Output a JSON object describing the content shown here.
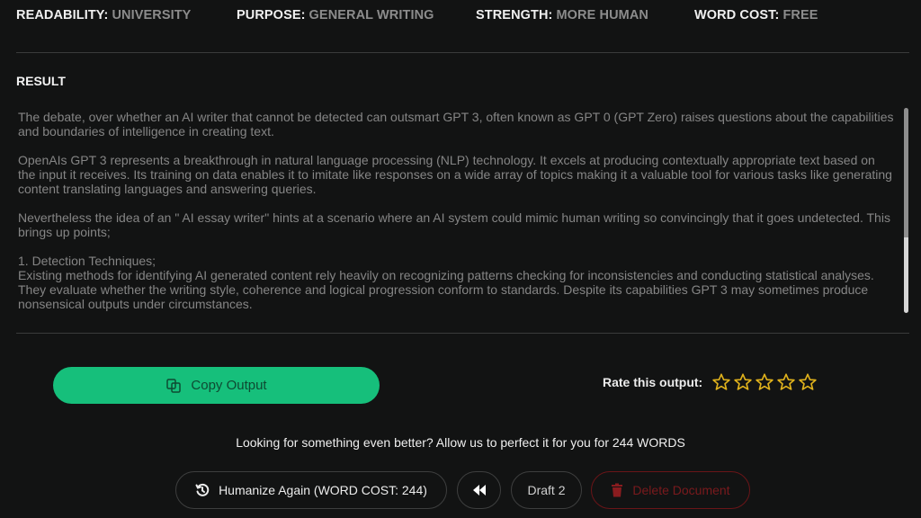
{
  "settings": {
    "readability": {
      "label": "READABILITY:",
      "value": "UNIVERSITY"
    },
    "purpose": {
      "label": "PURPOSE:",
      "value": "GENERAL WRITING"
    },
    "strength": {
      "label": "STRENGTH:",
      "value": "MORE HUMAN"
    },
    "word_cost": {
      "label": "WORD COST:",
      "value": "FREE"
    }
  },
  "result": {
    "label": "RESULT",
    "paragraphs": [
      "The debate, over whether an AI writer that cannot be detected can outsmart GPT 3, often known as GPT 0 (GPT Zero) raises questions about the capabilities and boundaries of intelligence in creating text.",
      "OpenAIs GPT 3 represents a breakthrough in natural language processing (NLP) technology. It excels at producing contextually appropriate text based on the input it receives. Its training on data enables it to imitate like responses on a wide array of topics making it a valuable tool for various tasks like generating content translating languages and answering queries.",
      "Nevertheless the idea of an \" AI essay writer\" hints at a scenario where an AI system could mimic human writing so convincingly that it goes undetected. This brings up points;",
      "1. Detection Techniques;\nExisting methods for identifying AI generated content rely heavily on recognizing patterns checking for inconsistencies and conducting statistical analyses. They evaluate whether the writing style, coherence and logical progression conform to standards. Despite its capabilities GPT 3 may sometimes produce nonsensical outputs under circumstances."
    ]
  },
  "actions": {
    "copy_label": "Copy Output",
    "rate_label": "Rate this output:",
    "rating": {
      "value": 0,
      "max": 5
    },
    "star_color": "#e0b21c",
    "upsell_text": "Looking for something even better? Allow us to perfect it for you for 244 WORDS",
    "humanize_label": "Humanize Again (WORD COST: 244)",
    "draft_label": "Draft 2",
    "delete_label": "Delete Document"
  },
  "colors": {
    "accent": "#16bf7b",
    "danger": "#7a1a1d",
    "background": "#121313"
  }
}
